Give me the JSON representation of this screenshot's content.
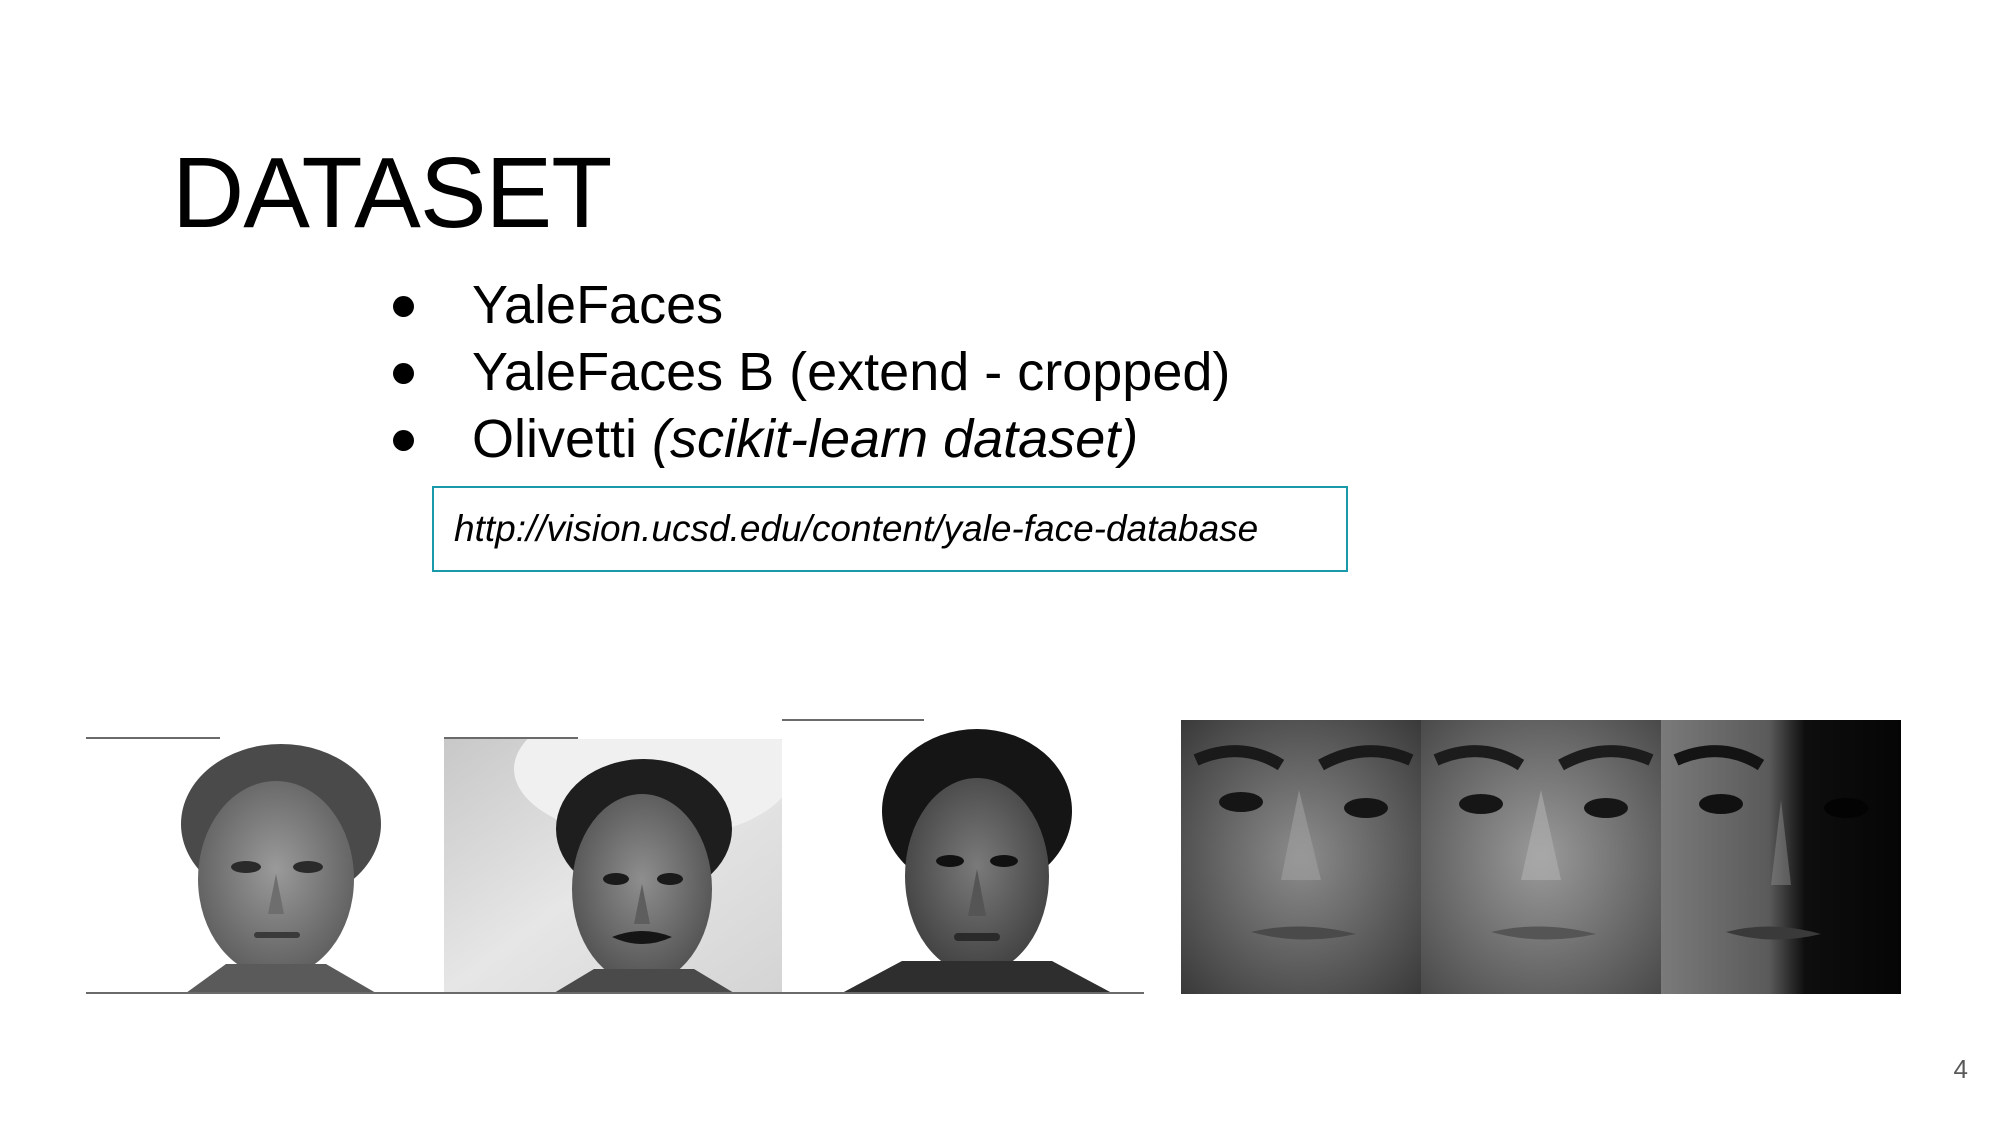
{
  "slide": {
    "title": "DATASET",
    "bullets": [
      {
        "text": "YaleFaces",
        "italic_suffix": ""
      },
      {
        "text": "YaleFaces B (extend - cropped)",
        "italic_suffix": ""
      },
      {
        "text": "Olivetti ",
        "italic_suffix": "(scikit-learn dataset)"
      }
    ],
    "link": "http://vision.ucsd.edu/content/yale-face-database",
    "page_number": "4",
    "accent_color": "#1a9aa8",
    "images": [
      {
        "name": "yale-face-photo-1"
      },
      {
        "name": "yale-face-photo-2"
      },
      {
        "name": "yale-face-photo-3"
      },
      {
        "name": "yale-b-cropped-strip"
      }
    ]
  }
}
